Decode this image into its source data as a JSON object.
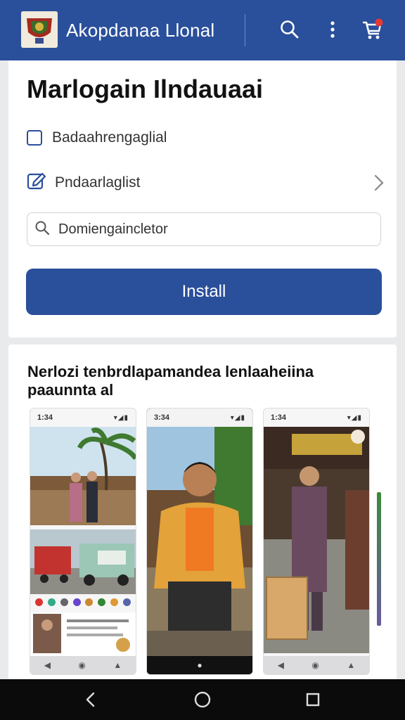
{
  "app": {
    "title": "Akopdanaa Llonal"
  },
  "appbar": {
    "icons": [
      "app-logo",
      "search-icon",
      "more-vert-icon",
      "cart-icon"
    ],
    "accent_color": "#2a4f9b"
  },
  "main": {
    "title": "Marlogain Ilndauaai",
    "option1_label": "Badaahrengaglial",
    "option2_label": "Pndaarlaglist",
    "search_placeholder": "Domiengaincletor",
    "install_label": "Install"
  },
  "screenshots": {
    "title": "Nerlozi tenbrdlapamandea lenlaaheiina paaunnta al",
    "items": [
      {
        "time": "1:34"
      },
      {
        "time": "3:34"
      },
      {
        "time": "1:34"
      }
    ]
  },
  "system_nav": {
    "icons": [
      "back-icon",
      "home-icon",
      "recents-icon"
    ]
  }
}
